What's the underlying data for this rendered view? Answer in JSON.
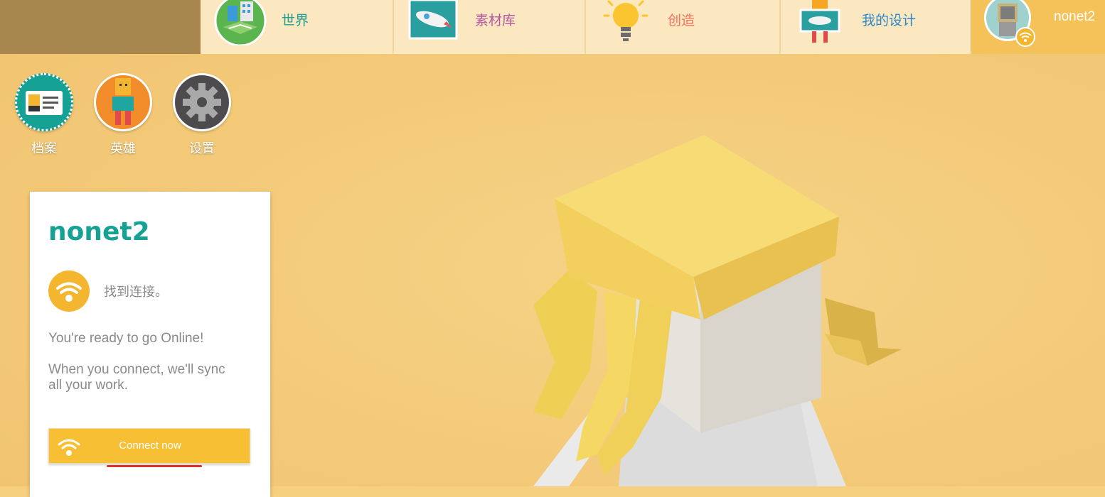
{
  "nav": {
    "tabs": [
      {
        "label": "世界",
        "icon": "world-city-icon",
        "color": "#1d9f95"
      },
      {
        "label": "素材库",
        "icon": "rocket-picture-icon",
        "color": "#b15ca3"
      },
      {
        "label": "创造",
        "icon": "lightbulb-icon",
        "color": "#f3705e"
      },
      {
        "label": "我的设计",
        "icon": "robot-picture-icon",
        "color": "#2d86c9"
      }
    ],
    "user": {
      "name": "nonet2",
      "icon": "offline-wifi-badge-icon"
    }
  },
  "side_buttons": [
    {
      "label": "档案",
      "icon": "id-card-icon"
    },
    {
      "label": "英雄",
      "icon": "hero-figure-icon"
    },
    {
      "label": "设置",
      "icon": "gear-icon"
    }
  ],
  "profile_card": {
    "username": "nonet2",
    "status": "找到连接。",
    "ready_message": "You're ready to go Online!",
    "sync_message": "When you connect, we'll sync all your work.",
    "connect_button": "Connect now"
  },
  "colors": {
    "background": "#f6cf7f",
    "accent_teal": "#16a195",
    "accent_yellow": "#f7bf34",
    "top_left_block": "#a8874f"
  }
}
